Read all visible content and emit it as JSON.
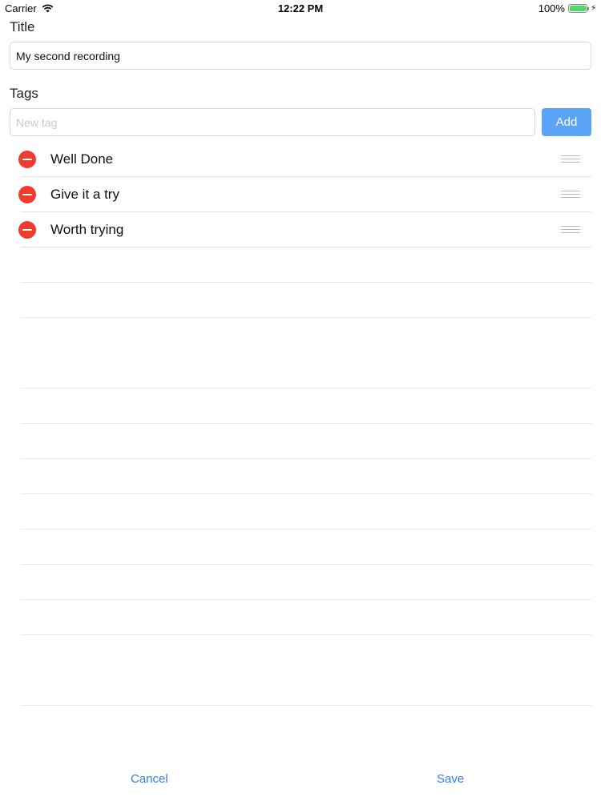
{
  "status_bar": {
    "carrier": "Carrier",
    "time": "12:22 PM",
    "battery": "100%",
    "battery_level": 1.0
  },
  "form": {
    "title_label": "Title",
    "title_value": "My second recording",
    "tags_label": "Tags",
    "tag_placeholder": "New tag",
    "add_label": "Add"
  },
  "tags": [
    {
      "label": "Well Done"
    },
    {
      "label": "Give it a try"
    },
    {
      "label": "Worth trying"
    }
  ],
  "bottom_bar": {
    "cancel_label": "Cancel",
    "save_label": "Save"
  },
  "colors": {
    "accent": "#2f7cf6",
    "add_button": "#5aa3f6",
    "delete": "#f23b30",
    "battery": "#4cd964"
  }
}
